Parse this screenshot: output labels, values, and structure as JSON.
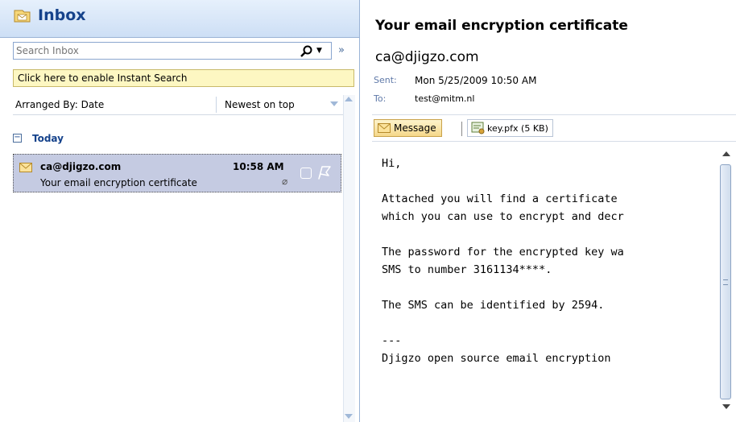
{
  "folder": {
    "title": "Inbox",
    "icon": "inbox-folder-icon"
  },
  "search": {
    "placeholder": "Search Inbox",
    "icon": "search-icon"
  },
  "instant_search": {
    "text": "Click here to enable Instant Search"
  },
  "arrange": {
    "label": "Arranged By: Date",
    "order": "Newest on top"
  },
  "groups": [
    {
      "label": "Today",
      "items": [
        {
          "from": "ca@djigzo.com",
          "time": "10:58 AM",
          "subject": "Your email encryption certificate",
          "has_attachment": true,
          "selected": true
        }
      ]
    }
  ],
  "reading": {
    "subject": "Your email encryption certificate",
    "sender": "ca@djigzo.com",
    "sent_label": "Sent:",
    "sent_value": "Mon 5/25/2009 10:50 AM",
    "to_label": "To:",
    "to_value": "test@mitm.nl",
    "message_tab": "Message",
    "attachment": "key.pfx (5 KB)",
    "body": "Hi,\n\nAttached you will find a certificate\nwhich you can use to encrypt and decr\n\nThe password for the encrypted key wa\nSMS to number 3161134****.\n\nThe SMS can be identified by 2594.\n\n---\nDjigzo open source email encryption"
  },
  "colors": {
    "header_text": "#15428b",
    "selected_row": "#c5cbe2",
    "instant_search_bg": "#fdf7c2"
  }
}
